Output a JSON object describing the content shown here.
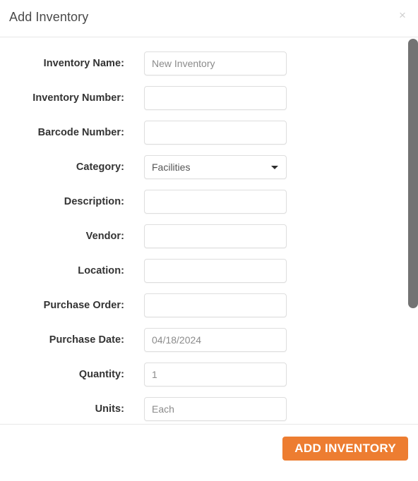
{
  "modal": {
    "title": "Add Inventory",
    "close_icon": "close-icon",
    "close_label": "×"
  },
  "form": {
    "fields": [
      {
        "label": "Inventory Name:",
        "name": "inventory-name",
        "type": "text",
        "value": "",
        "placeholder": "New Inventory"
      },
      {
        "label": "Inventory Number:",
        "name": "inventory-number",
        "type": "text",
        "value": "",
        "placeholder": ""
      },
      {
        "label": "Barcode Number:",
        "name": "barcode-number",
        "type": "text",
        "value": "",
        "placeholder": ""
      },
      {
        "label": "Category:",
        "name": "category",
        "type": "select",
        "value": "Facilities",
        "placeholder": ""
      },
      {
        "label": "Description:",
        "name": "description",
        "type": "text",
        "value": "",
        "placeholder": ""
      },
      {
        "label": "Vendor:",
        "name": "vendor",
        "type": "text",
        "value": "",
        "placeholder": ""
      },
      {
        "label": "Location:",
        "name": "location",
        "type": "text",
        "value": "",
        "placeholder": ""
      },
      {
        "label": "Purchase Order:",
        "name": "purchase-order",
        "type": "text",
        "value": "",
        "placeholder": ""
      },
      {
        "label": "Purchase Date:",
        "name": "purchase-date",
        "type": "text",
        "value": "",
        "placeholder": "04/18/2024"
      },
      {
        "label": "Quantity:",
        "name": "quantity",
        "type": "text",
        "value": "",
        "placeholder": "1"
      },
      {
        "label": "Units:",
        "name": "units",
        "type": "text",
        "value": "",
        "placeholder": "Each"
      }
    ]
  },
  "footer": {
    "submit_label": "ADD INVENTORY"
  },
  "colors": {
    "accent": "#ed7d31",
    "scrollbar_thumb": "#737373",
    "border": "#dedede",
    "label_text": "#333333",
    "placeholder_text": "#8b8b8b"
  }
}
